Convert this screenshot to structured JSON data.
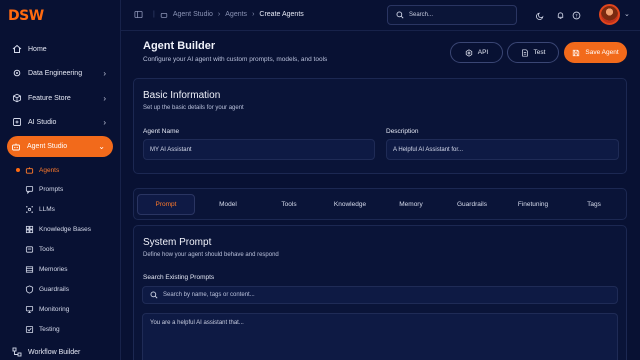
{
  "brand": {
    "logo": "DSW",
    "accent": "#f26a1b"
  },
  "sidebar": {
    "items": [
      {
        "label": "Home",
        "icon": "home-icon"
      },
      {
        "label": "Data Engineering",
        "icon": "gear-icon"
      },
      {
        "label": "Feature Store",
        "icon": "box-icon"
      },
      {
        "label": "AI Studio",
        "icon": "ai-icon"
      },
      {
        "label": "Agent Studio",
        "icon": "robot-icon"
      },
      {
        "label": "Workflow Builder",
        "icon": "workflow-icon"
      }
    ],
    "sub_items": [
      {
        "label": "Agents",
        "icon": "robot-icon"
      },
      {
        "label": "Prompts",
        "icon": "chat-icon"
      },
      {
        "label": "LLMs",
        "icon": "network-icon"
      },
      {
        "label": "Knowledge Bases",
        "icon": "grid-icon"
      },
      {
        "label": "Tools",
        "icon": "tool-icon"
      },
      {
        "label": "Memories",
        "icon": "memory-icon"
      },
      {
        "label": "Guardrails",
        "icon": "shield-icon"
      },
      {
        "label": "Monitoring",
        "icon": "monitor-icon"
      },
      {
        "label": "Testing",
        "icon": "flask-icon"
      }
    ]
  },
  "header": {
    "breadcrumbs": [
      "Agent Studio",
      "Agents",
      "Create Agents"
    ],
    "search_placeholder": "Search..."
  },
  "page": {
    "title": "Agent Builder",
    "subtitle": "Configure your AI agent with custom prompts, models, and tools",
    "buttons": {
      "api": "API",
      "test": "Test",
      "save": "Save Agent"
    }
  },
  "basic_info": {
    "title": "Basic Information",
    "subtitle": "Set up the basic details for your agent",
    "agent_name_label": "Agent Name",
    "agent_name_value": "MY AI Assistant",
    "description_label": "Description",
    "description_value": "A Helpful AI Assistant for..."
  },
  "tabs": [
    "Prompt",
    "Model",
    "Tools",
    "Knowledge",
    "Memory",
    "Guardrails",
    "Finetuning",
    "Tags"
  ],
  "system_prompt": {
    "title": "System Prompt",
    "subtitle": "Define how your agent should behave and respond",
    "search_label": "Search Existing Prompts",
    "search_placeholder": "Search by name, tags or content...",
    "prompt_text": "You are a helpful AI assistant that..."
  }
}
